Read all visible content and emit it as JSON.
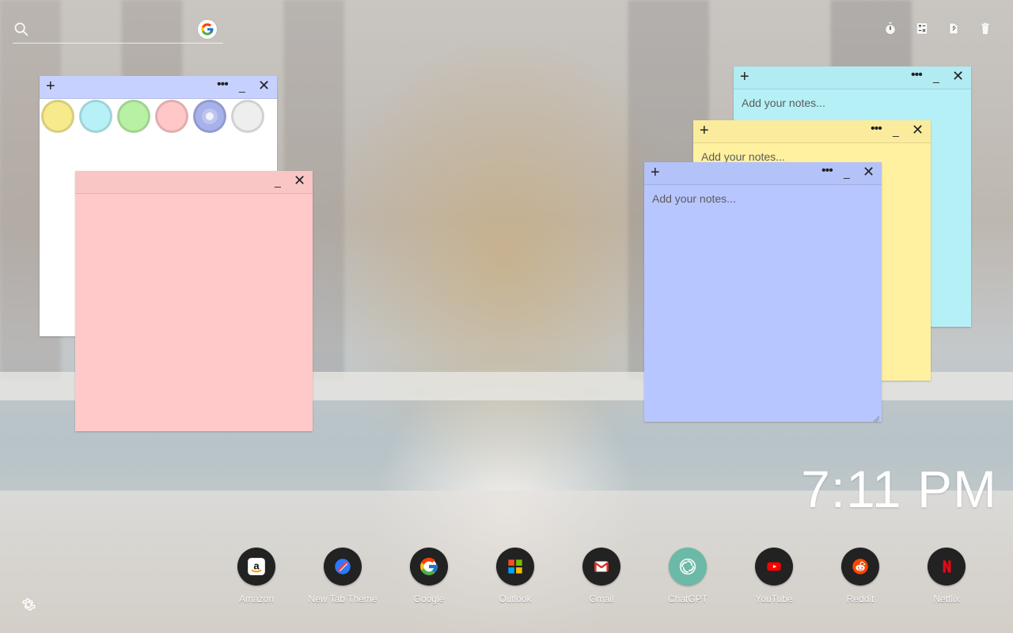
{
  "search": {
    "placeholder": "",
    "engine_icon": "google-g-icon"
  },
  "toolbar": {
    "icons": [
      "stopwatch-icon",
      "calculator-icon",
      "sticky-note-icon",
      "trash-icon"
    ]
  },
  "notes": {
    "placeholder": "Add your notes...",
    "controls": {
      "add": "+",
      "more": "•••",
      "minimize": "_",
      "close": "✕"
    },
    "palette": {
      "colors": [
        "#f6ea8d",
        "#b7f1f7",
        "#b8f1a3",
        "#ffc7c7",
        "#a7b1ea",
        "#eeeeee"
      ],
      "selected_index": 4
    },
    "colors": {
      "white": "#ffffff",
      "pink": "#ffc9c9",
      "green": "#b3f99f",
      "cyan": "#b6f0f7",
      "yellow": "#fff1a0",
      "periwinkle": "#b8c6ff"
    }
  },
  "clock": {
    "time": "7:11 PM"
  },
  "dock": {
    "apps": [
      {
        "name": "Amazon",
        "icon": "amazon-icon"
      },
      {
        "name": "New Tab Theme",
        "icon": "new-tab-theme-icon"
      },
      {
        "name": "Google",
        "icon": "google-icon"
      },
      {
        "name": "Outlook",
        "icon": "outlook-icon"
      },
      {
        "name": "Gmail",
        "icon": "gmail-icon"
      },
      {
        "name": "ChatGPT",
        "icon": "chatgpt-icon"
      },
      {
        "name": "YouTube",
        "icon": "youtube-icon"
      },
      {
        "name": "Reddit",
        "icon": "reddit-icon"
      },
      {
        "name": "Netflix",
        "icon": "netflix-icon"
      }
    ]
  },
  "settings": {
    "icon": "gear-icon"
  }
}
